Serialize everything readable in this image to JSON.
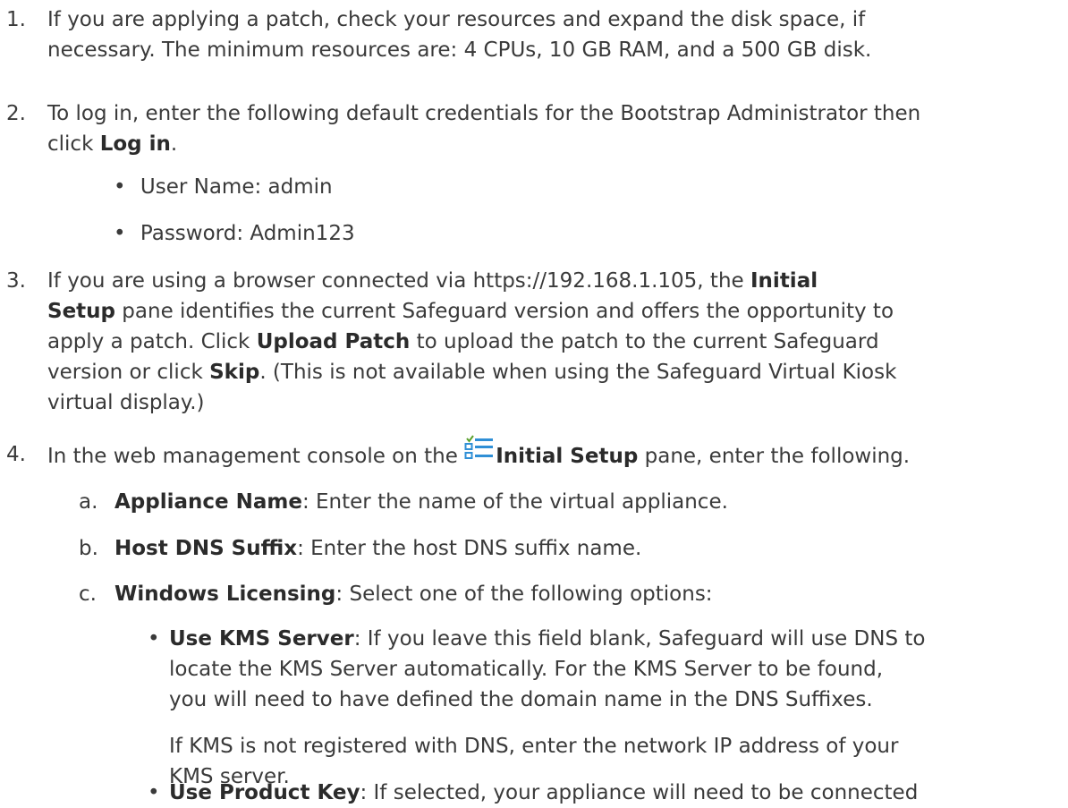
{
  "steps": [
    {
      "num": "1.",
      "lines": [
        "If you are applying a patch, check your resources and expand the disk space, if",
        "necessary. The minimum resources are: 4 CPUs, 10 GB RAM, and a 500 GB disk."
      ]
    },
    {
      "num": "2.",
      "line1": "To log in, enter the following default credentials for the Bootstrap Administrator then",
      "line2_pre": "click ",
      "line2_bold": "Log in",
      "line2_post": ".",
      "bullets": [
        "User Name: admin",
        "Password: Admin123"
      ]
    },
    {
      "num": "3.",
      "l1_pre": "If you are using a browser connected via https://192.168.1.105, the ",
      "l1_bold": "Initial",
      "l2_bold": "Setup",
      "l2_post": " pane identifies the current Safeguard version and offers the opportunity to",
      "l3_pre": "apply a patch. Click ",
      "l3_bold": "Upload Patch",
      "l3_post": " to upload the patch to the current Safeguard",
      "l4_pre": "version or click ",
      "l4_bold": "Skip",
      "l4_post": ". (This is not available when using the Safeguard Virtual Kiosk",
      "l5": "virtual display.)"
    },
    {
      "num": "4.",
      "pre": "In the web management console on the ",
      "bold": "Initial Setup",
      "post": " pane, enter the following.",
      "icon": "initial-setup-icon",
      "subitems": [
        {
          "letter": "a.",
          "bold": "Appliance Name",
          "text": ": Enter the name of the virtual appliance."
        },
        {
          "letter": "b.",
          "bold": "Host DNS Suffix",
          "text": ": Enter the host DNS suffix name."
        },
        {
          "letter": "c.",
          "bold": "Windows Licensing",
          "text": ": Select one of the following options:"
        }
      ],
      "options": [
        {
          "bold": "Use KMS Server",
          "l1": ": If you leave this field blank, Safeguard will use DNS to",
          "l2": "locate the KMS Server automatically. For the KMS Server to be found,",
          "l3": "you will need to have defined the domain name in the DNS Suffixes.",
          "p2_l1": "If KMS is not registered with DNS, enter the network IP address of your",
          "p2_l2": "KMS server."
        },
        {
          "bold": "Use Product Key",
          "l1": ": If selected, your appliance will need to be connected"
        }
      ]
    }
  ]
}
